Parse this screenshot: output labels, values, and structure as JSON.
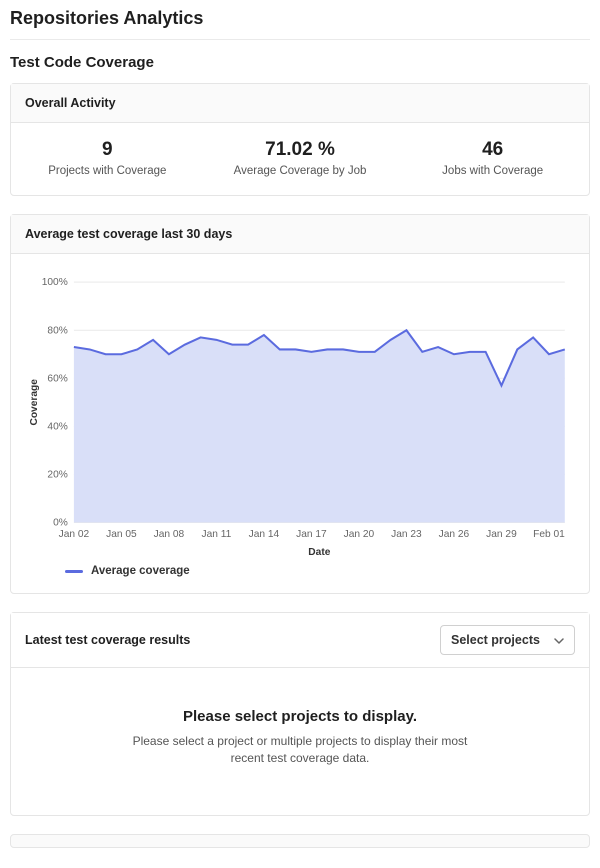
{
  "page_title": "Repositories Analytics",
  "section_title": "Test Code Coverage",
  "overall": {
    "header": "Overall Activity",
    "stats": [
      {
        "value": "9",
        "label": "Projects with Coverage"
      },
      {
        "value": "71.02 %",
        "label": "Average Coverage by Job"
      },
      {
        "value": "46",
        "label": "Jobs with Coverage"
      }
    ]
  },
  "chart_panel_header": "Average test coverage last 30 days",
  "legend": {
    "label": "Average coverage",
    "color": "#5b6bdf"
  },
  "chart_data": {
    "type": "area",
    "xlabel": "Date",
    "ylabel": "Coverage",
    "ylim": [
      0,
      100
    ],
    "y_ticks": [
      0,
      20,
      40,
      60,
      80,
      100
    ],
    "x_tick_labels": [
      "Jan 02",
      "Jan 05",
      "Jan 08",
      "Jan 11",
      "Jan 14",
      "Jan 17",
      "Jan 20",
      "Jan 23",
      "Jan 26",
      "Jan 29",
      "Feb 01"
    ],
    "series": [
      {
        "name": "Average coverage",
        "color": "#5b6bdf",
        "fill": "#d9dff8",
        "x": [
          "Jan 02",
          "Jan 03",
          "Jan 04",
          "Jan 05",
          "Jan 06",
          "Jan 07",
          "Jan 08",
          "Jan 09",
          "Jan 10",
          "Jan 11",
          "Jan 12",
          "Jan 13",
          "Jan 14",
          "Jan 15",
          "Jan 16",
          "Jan 17",
          "Jan 18",
          "Jan 19",
          "Jan 20",
          "Jan 21",
          "Jan 22",
          "Jan 23",
          "Jan 24",
          "Jan 25",
          "Jan 26",
          "Jan 27",
          "Jan 28",
          "Jan 29",
          "Jan 30",
          "Jan 31",
          "Feb 01",
          "Feb 02"
        ],
        "values": [
          73,
          72,
          70,
          70,
          72,
          76,
          70,
          74,
          77,
          76,
          74,
          74,
          78,
          72,
          72,
          71,
          72,
          72,
          71,
          71,
          76,
          80,
          71,
          73,
          70,
          71,
          71,
          57,
          72,
          77,
          70,
          72
        ]
      }
    ]
  },
  "latest": {
    "header": "Latest test coverage results",
    "select_label": "Select projects",
    "empty_title": "Please select projects to display.",
    "empty_sub": "Please select a project or multiple projects to display their most recent test coverage data."
  }
}
